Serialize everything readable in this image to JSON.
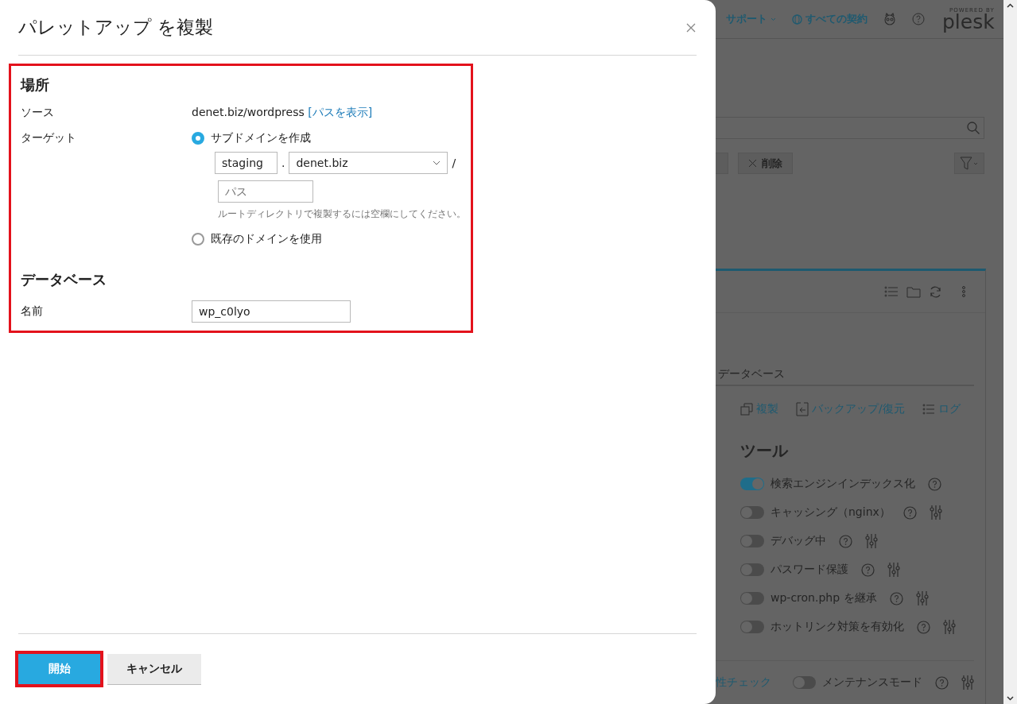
{
  "dialog": {
    "title": "パレットアップ を複製",
    "form_highlighted": true,
    "location": {
      "heading": "場所",
      "source_label": "ソース",
      "source_value": "denet.biz/wordpress",
      "source_link": "[パスを表示]",
      "target_label": "ターゲット",
      "target_options": [
        {
          "label": "サブドメインを作成",
          "selected": true
        },
        {
          "label": "既存のドメインを使用",
          "selected": false
        }
      ],
      "subdomain": {
        "value": "staging",
        "separator": ".",
        "domain": "denet.biz",
        "slash": "/",
        "path_placeholder": "パス",
        "hint": "ルートディレクトリで複製するには空欄にしてください。"
      }
    },
    "database": {
      "heading": "データベース",
      "name_label": "名前",
      "name_value": "wp_c0lyo"
    },
    "buttons": [
      {
        "label": "開始",
        "kind": "primary",
        "highlighted": true
      },
      {
        "label": "キャンセル",
        "kind": "secondary",
        "highlighted": false
      }
    ]
  },
  "background_page": {
    "nav": [
      {
        "label": "サポート",
        "kind": "menu"
      },
      {
        "label": "すべての契約",
        "kind": "link"
      }
    ],
    "logo": {
      "tagline": "POWERED BY",
      "name": "plesk"
    },
    "delete_button": "削除",
    "tab": "データベース",
    "actions": [
      {
        "label": "複製",
        "kind": "copy"
      },
      {
        "label": "バックアップ/復元",
        "kind": "backup"
      },
      {
        "label": "ログ",
        "kind": "log"
      }
    ],
    "tools_heading": "ツール",
    "tools": [
      {
        "label": "検索エンジンインデックス化",
        "on": true,
        "settings": false
      },
      {
        "label": "キャッシング（nginx）",
        "on": false,
        "settings": true
      },
      {
        "label": "デバッグ中",
        "on": false,
        "settings": true
      },
      {
        "label": "パスワード保護",
        "on": false,
        "settings": true
      },
      {
        "label": "wp-cron.php を継承",
        "on": false,
        "settings": true
      },
      {
        "label": "ホットリンク対策を有効化",
        "on": false,
        "settings": true
      }
    ],
    "bottom_link": "性チェック",
    "bottom_tool": {
      "label": "メンテナンスモード",
      "on": false,
      "settings": true
    }
  }
}
